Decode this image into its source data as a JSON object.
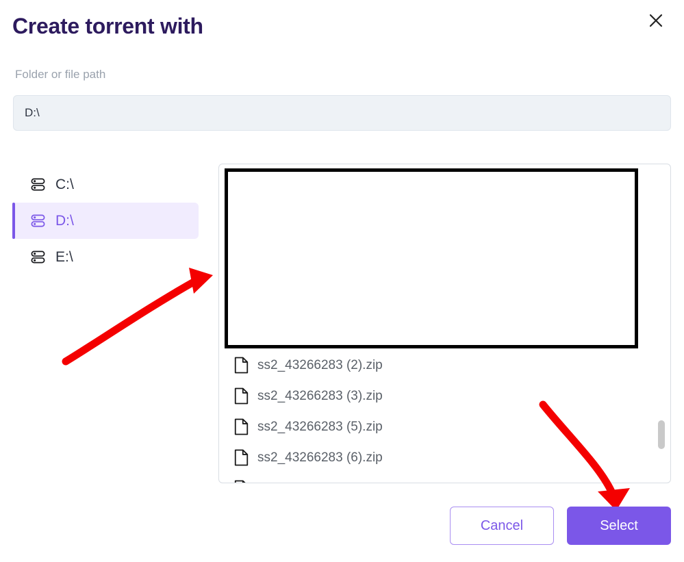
{
  "dialog": {
    "title": "Create torrent with",
    "close_icon": "close-icon"
  },
  "path_field": {
    "label": "Folder or file path",
    "value": "D:\\",
    "placeholder": "Folder or file path"
  },
  "drives": {
    "items": [
      {
        "label": "C:\\",
        "icon": "drive-icon",
        "selected": false
      },
      {
        "label": "D:\\",
        "icon": "drive-icon",
        "selected": true
      },
      {
        "label": "E:\\",
        "icon": "drive-icon",
        "selected": false
      }
    ]
  },
  "file_browser": {
    "files": [
      {
        "name": "ss2_43266283 (2).zip",
        "icon": "file-icon"
      },
      {
        "name": "ss2_43266283 (3).zip",
        "icon": "file-icon"
      },
      {
        "name": "ss2_43266283 (5).zip",
        "icon": "file-icon"
      },
      {
        "name": "ss2_43266283 (6).zip",
        "icon": "file-icon"
      }
    ],
    "scrollbar": "vertical-scrollbar"
  },
  "footer": {
    "cancel_label": "Cancel",
    "select_label": "Select"
  },
  "annotations": {
    "highlight_box": "black-rectangle-highlight",
    "arrow_1": "red-arrow-pointing-to-file-panel",
    "arrow_2": "red-arrow-pointing-to-select-button"
  },
  "colors": {
    "accent": "#7b57e8",
    "accent_soft": "#f1ecfe",
    "title": "#2d1b5e",
    "label": "#9aa2ad",
    "input_bg": "#eef2f6",
    "annotation": "#f40000",
    "file_text": "#5a6068"
  }
}
